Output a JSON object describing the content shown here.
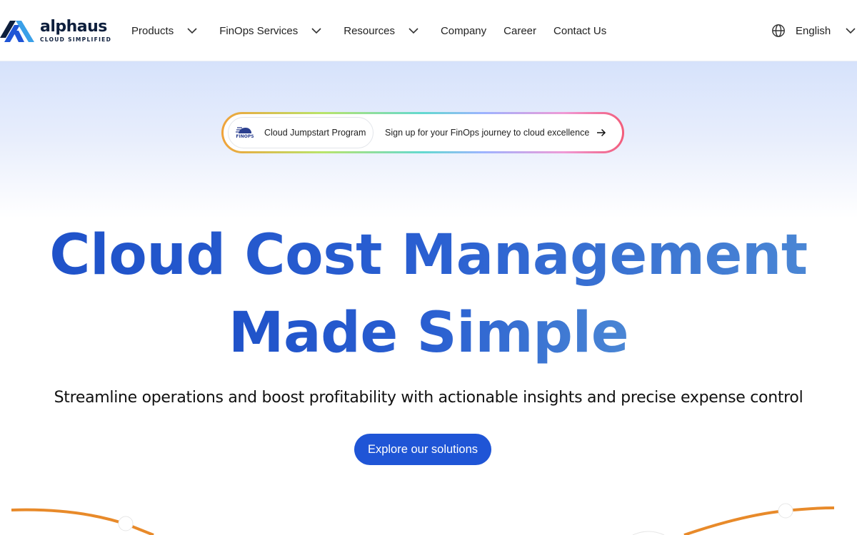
{
  "brand": {
    "name": "alphaus",
    "tagline": "CLOUD SIMPLIFIED",
    "colors": {
      "dark": "#0e1f3d",
      "blue": "#1f55d6",
      "light_blue": "#3aa0e8"
    }
  },
  "nav": {
    "items": [
      {
        "label": "Products",
        "has_dropdown": true
      },
      {
        "label": "FinOps Services",
        "has_dropdown": true
      },
      {
        "label": "Resources",
        "has_dropdown": true
      },
      {
        "label": "Company",
        "has_dropdown": false
      },
      {
        "label": "Career",
        "has_dropdown": false
      },
      {
        "label": "Contact Us",
        "has_dropdown": false
      }
    ],
    "language": {
      "label": "English",
      "icon": "globe-icon"
    }
  },
  "announcement": {
    "badge_logo_text": "FINOPS",
    "badge_label": "Cloud Jumpstart Program",
    "text": "Sign up for your FinOps journey to cloud excellence",
    "icon": "arrow-right-icon"
  },
  "hero": {
    "headline_line1": "Cloud Cost Management",
    "headline_line2": "Made Simple",
    "subtitle": "Streamline operations and boost profitability with actionable insights and precise expense control",
    "cta_label": "Explore our solutions",
    "colors": {
      "headline_start": "#1f52c9",
      "headline_end": "#4a86d4",
      "cta": "#1f55d6",
      "curve": "#e88a2a"
    }
  }
}
